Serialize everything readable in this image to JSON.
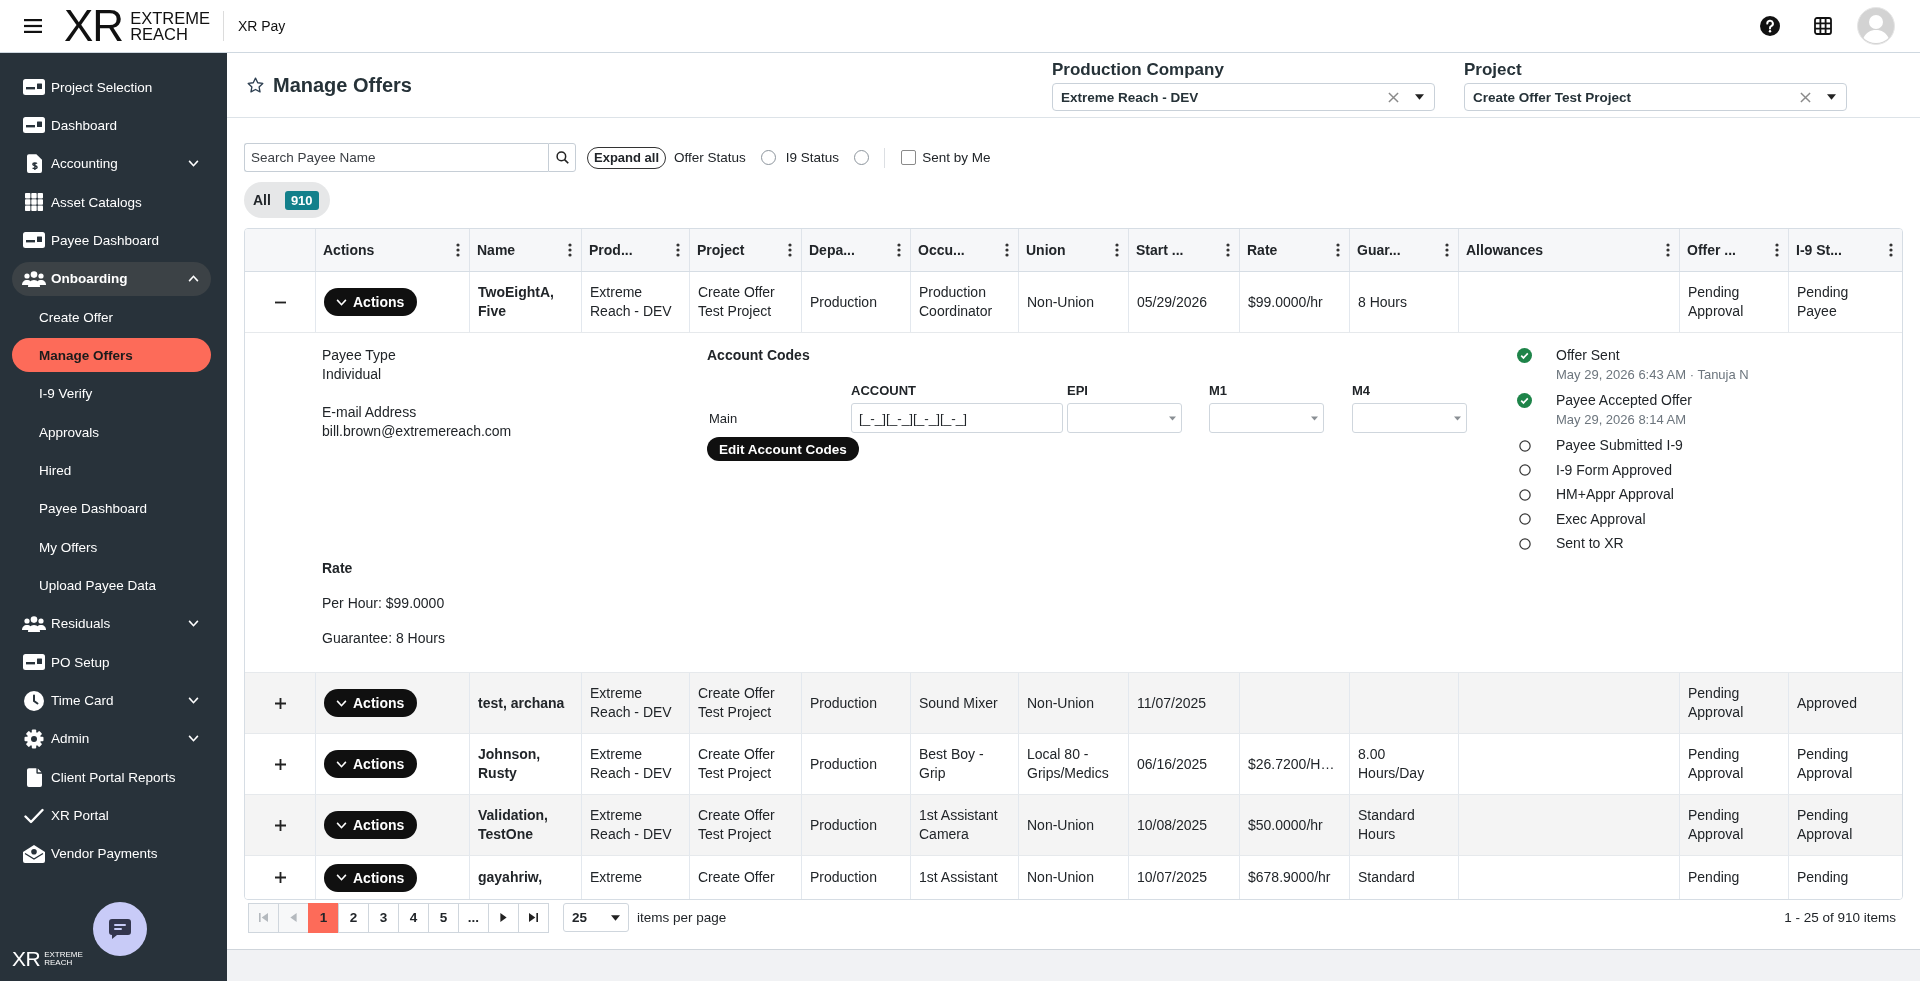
{
  "header": {
    "logo": {
      "mark": "XR",
      "lines": [
        "EXTREME",
        "REACH"
      ]
    },
    "app_name": "XR Pay"
  },
  "sidebar": {
    "items": [
      {
        "label": "Project Selection",
        "selected": false
      },
      {
        "label": "Dashboard",
        "selected": false
      },
      {
        "label": "Accounting",
        "selected": false,
        "expanded": false
      },
      {
        "label": "Asset Catalogs",
        "selected": false
      },
      {
        "label": "Payee Dashboard",
        "selected": false
      },
      {
        "label": "Onboarding",
        "selected": false,
        "expanded": true,
        "children": [
          {
            "label": "Create Offer",
            "selected": false
          },
          {
            "label": "Manage Offers",
            "selected": true
          },
          {
            "label": "I-9 Verify",
            "selected": false
          },
          {
            "label": "Approvals",
            "selected": false
          },
          {
            "label": "Hired",
            "selected": false
          },
          {
            "label": "Payee Dashboard",
            "selected": false
          },
          {
            "label": "My Offers",
            "selected": false
          },
          {
            "label": "Upload Payee Data",
            "selected": false
          }
        ]
      },
      {
        "label": "Residuals",
        "selected": false,
        "expanded": false
      },
      {
        "label": "PO Setup",
        "selected": false
      },
      {
        "label": "Time Card",
        "selected": false,
        "expanded": false
      },
      {
        "label": "Admin",
        "selected": false,
        "expanded": false
      },
      {
        "label": "Client Portal Reports",
        "selected": false
      },
      {
        "label": "XR Portal",
        "selected": false
      },
      {
        "label": "Vendor Payments",
        "selected": false
      }
    ],
    "footer_logo": {
      "mark": "XR",
      "lines": [
        "EXTREME",
        "REACH"
      ]
    }
  },
  "page": {
    "title": "Manage Offers",
    "starred": false,
    "selectors": [
      {
        "label": "Production Company",
        "value": "Extreme Reach - DEV"
      },
      {
        "label": "Project",
        "value": "Create Offer Test Project"
      }
    ]
  },
  "filters": {
    "search": {
      "placeholder": "Search Payee Name"
    },
    "expand_all": "Expand all",
    "status_toggles": [
      {
        "label": "Offer Status",
        "on": false
      },
      {
        "label": "I9 Status",
        "on": false
      }
    ],
    "sent_by_me": {
      "label": "Sent by Me",
      "checked": false
    }
  },
  "tabs": [
    {
      "label": "All",
      "count": "910",
      "selected": true
    }
  ],
  "table": {
    "columns": [
      "Actions",
      "Name",
      "Prod...",
      "Project",
      "Depa...",
      "Occu...",
      "Union",
      "Start ...",
      "Rate",
      "Guar...",
      "Allowances",
      "Offer ...",
      "I-9 St..."
    ],
    "rows": [
      {
        "expanded": true,
        "cells": [
          "Actions",
          "TwoEightA, Five",
          "Extreme Reach - DEV",
          "Create Offer Test Project",
          "Production",
          "Production Coordinator",
          "Non-Union",
          "05/29/2026",
          "$99.0000/hr",
          "8 Hours",
          null,
          "Pending Approval",
          "Pending Payee"
        ],
        "detail": {
          "fields": [
            {
              "label": "Payee Type",
              "value": "Individual"
            },
            {
              "label": "E-mail Address",
              "value": "bill.brown@extremereach.com"
            }
          ],
          "rate": {
            "title": "Rate",
            "lines": [
              "Per Hour: $99.0000",
              "Guarantee: 8 Hours"
            ]
          },
          "account_codes": {
            "title": "Account Codes",
            "columns": [
              {
                "label": "ACCOUNT",
                "kind": "input"
              },
              {
                "label": "EPI",
                "kind": "select"
              },
              {
                "label": "M1",
                "kind": "select"
              },
              {
                "label": "M4",
                "kind": "select"
              }
            ],
            "rows": [
              {
                "label": "Main",
                "value": "[_-_][_-_][_-_][_-_]"
              }
            ],
            "button": "Edit Account Codes"
          },
          "timeline": [
            {
              "label": "Offer Sent",
              "note": "May 29, 2026 6:43 AM · Tanuja N",
              "done": true
            },
            {
              "label": "Payee Accepted Offer",
              "note": "May 29, 2026 8:14 AM",
              "done": true
            },
            {
              "label": "Payee Submitted I-9",
              "done": false
            },
            {
              "label": "I-9 Form Approved",
              "done": false
            },
            {
              "label": "HM+Appr Approval",
              "done": false
            },
            {
              "label": "Exec Approval",
              "done": false
            },
            {
              "label": "Sent to XR",
              "done": false
            }
          ]
        }
      },
      {
        "expanded": false,
        "cells": [
          "Actions",
          "test, archana",
          "Extreme Reach - DEV",
          "Create Offer Test Project",
          "Production",
          "Sound Mixer",
          "Non-Union",
          "11/07/2025",
          null,
          null,
          null,
          "Pending Approval",
          "Approved"
        ]
      },
      {
        "expanded": false,
        "cells": [
          "Actions",
          "Johnson, Rusty",
          "Extreme Reach - DEV",
          "Create Offer Test Project",
          "Production",
          "Best Boy - Grip",
          "Local 80 - Grips/Medics",
          "06/16/2025",
          "$26.7200/H…",
          "8.00 Hours/Day",
          null,
          "Pending Approval",
          "Pending Approval"
        ]
      },
      {
        "expanded": false,
        "cells": [
          "Actions",
          "Validation, TestOne",
          "Extreme Reach - DEV",
          "Create Offer Test Project",
          "Production",
          "1st Assistant Camera",
          "Non-Union",
          "10/08/2025",
          "$50.0000/hr",
          "Standard Hours",
          null,
          "Pending Approval",
          "Pending Approval"
        ]
      },
      {
        "expanded": false,
        "cells": [
          "Actions",
          "gayahriw,",
          "Extreme",
          "Create Offer",
          "Production",
          "1st Assistant",
          "Non-Union",
          "10/07/2025",
          "$678.9000/hr",
          "Standard",
          null,
          "Pending",
          "Pending"
        ]
      }
    ]
  },
  "pagination": {
    "nav_before": [
      {
        "kind": "first",
        "disabled": true
      },
      {
        "kind": "prev",
        "disabled": true
      }
    ],
    "pages": [
      {
        "label": "1",
        "selected": true
      },
      {
        "label": "2",
        "selected": false
      },
      {
        "label": "3",
        "selected": false
      },
      {
        "label": "4",
        "selected": false
      },
      {
        "label": "5",
        "selected": false
      },
      {
        "label": "...",
        "selected": false
      }
    ],
    "nav_after": [
      {
        "kind": "next",
        "disabled": false
      },
      {
        "kind": "last",
        "disabled": false
      }
    ],
    "page_size": "25",
    "page_size_label": "items per page",
    "summary": "1 - 25 of 910 items"
  }
}
